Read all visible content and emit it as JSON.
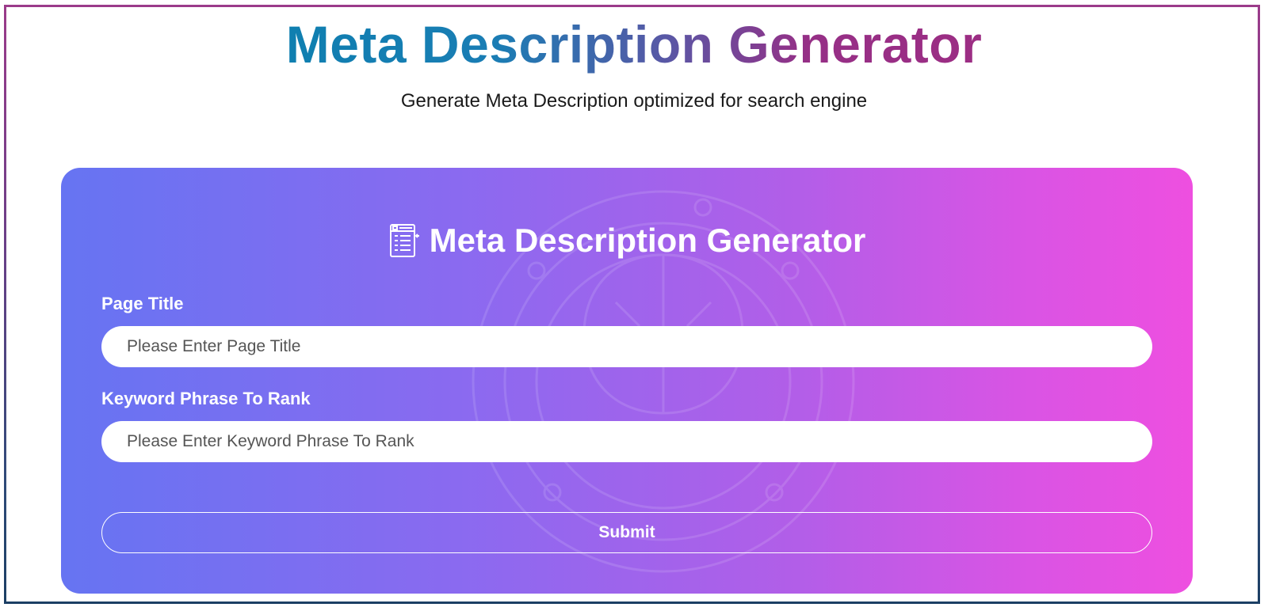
{
  "header": {
    "title": "Meta Description Generator",
    "subtitle": "Generate Meta Description optimized for search engine"
  },
  "card": {
    "title": "Meta Description Generator",
    "icon": "document-list-icon",
    "fields": [
      {
        "label": "Page Title",
        "value": "",
        "placeholder": "Please Enter Page Title"
      },
      {
        "label": "Keyword Phrase To Rank",
        "value": "",
        "placeholder": "Please Enter Keyword Phrase To Rank"
      }
    ],
    "submit_label": "Submit"
  },
  "colors": {
    "title_gradient_start": "#0f7fb0",
    "title_gradient_end": "#9c2e84",
    "card_gradient_start": "#6674f2",
    "card_gradient_end": "#ee4fe0",
    "frame_top": "#9b3b8a",
    "frame_bottom": "#1c3f64"
  }
}
